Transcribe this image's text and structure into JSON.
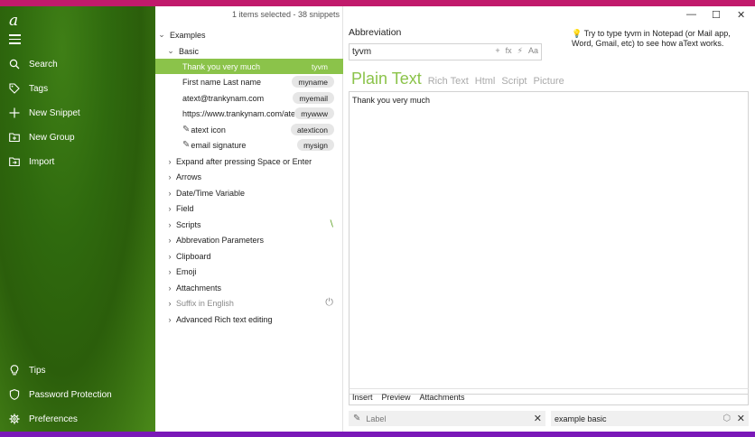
{
  "app": {
    "logo": "a"
  },
  "sidebar": {
    "nav": [
      {
        "label": "Search",
        "icon": "search-icon"
      },
      {
        "label": "Tags",
        "icon": "tag-icon"
      },
      {
        "label": "New Snippet",
        "icon": "plus-icon"
      },
      {
        "label": "New Group",
        "icon": "folder-plus-icon"
      },
      {
        "label": "Import",
        "icon": "import-folder-icon"
      }
    ],
    "bottom": [
      {
        "label": "Tips",
        "icon": "bulb-icon"
      },
      {
        "label": "Password Protection",
        "icon": "shield-icon"
      },
      {
        "label": "Preferences",
        "icon": "gear-icon"
      }
    ]
  },
  "list": {
    "status": "1 items selected - 38 snippets",
    "root": "Examples",
    "group": "Basic",
    "snippets": [
      {
        "label": "Thank you very much",
        "abbr": "tyvm",
        "selected": true
      },
      {
        "label": "First name Last name",
        "abbr": "myname"
      },
      {
        "label": "atext@trankynam.com",
        "abbr": "myemail"
      },
      {
        "label": "https://www.trankynam.com/ate",
        "abbr": "mywww"
      },
      {
        "label": "atext icon",
        "abbr": "atexticon",
        "pen": true
      },
      {
        "label": "email signature",
        "abbr": "mysign",
        "pen": true
      }
    ],
    "groups": [
      "Expand after pressing Space or Enter",
      "Arrows",
      "Date/Time Variable",
      "Field",
      "Scripts",
      "Abbrevation Parameters",
      "Clipboard",
      "Emoji",
      "Attachments",
      "Suffix in English",
      "Advanced Rich text editing"
    ]
  },
  "editor": {
    "abbreviation_label": "Abbreviation",
    "abbreviation_value": "tyvm",
    "tools": [
      "+",
      "fx",
      "⚡",
      "Aa"
    ],
    "hint": "Try to type tyvm in Notepad (or Mail app, Word, Gmail, etc) to see how aText works.",
    "tabs": [
      "Plain Text",
      "Rich Text",
      "Html",
      "Script",
      "Picture"
    ],
    "active_tab": "Plain Text",
    "content": "Thank you very much",
    "bottom_tabs": [
      "Insert",
      "Preview",
      "Attachments"
    ],
    "label_placeholder": "Label",
    "tag_value": "example basic"
  },
  "colors": {
    "accent": "#8bc34a",
    "top_strip": "#c11a6c",
    "bottom_strip": "#7a18b8"
  }
}
